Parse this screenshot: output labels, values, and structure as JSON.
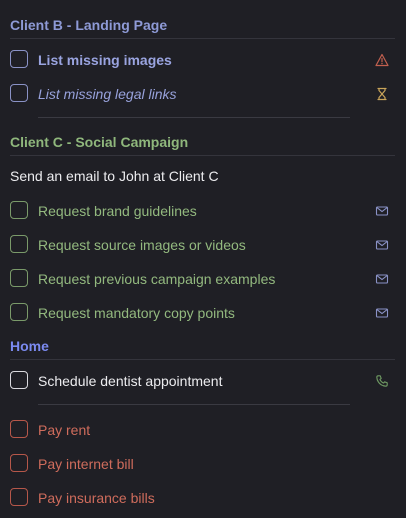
{
  "sections": {
    "client_b": {
      "title": "Client B - Landing Page",
      "tasks": [
        {
          "label": "List missing images",
          "icon": "warning-icon"
        },
        {
          "label": "List missing legal links",
          "icon": "hourglass-icon"
        }
      ]
    },
    "client_c": {
      "title": "Client C - Social Campaign",
      "subheading": "Send an email to John at Client C",
      "tasks": [
        {
          "label": "Request brand guidelines",
          "icon": "mail-icon"
        },
        {
          "label": "Request source images or videos",
          "icon": "mail-icon"
        },
        {
          "label": "Request previous campaign examples",
          "icon": "mail-icon"
        },
        {
          "label": "Request mandatory copy points",
          "icon": "mail-icon"
        }
      ]
    },
    "home": {
      "title": "Home",
      "tasks": [
        {
          "label": "Schedule dentist appointment",
          "icon": "phone-icon"
        },
        {
          "label": "Pay rent"
        },
        {
          "label": "Pay internet bill"
        },
        {
          "label": "Pay insurance bills"
        }
      ]
    }
  },
  "colors": {
    "background": "#1f1f25",
    "client_b_accent": "#8e9ad6",
    "client_c_accent": "#8fb77c",
    "home_accent": "#7b8af0",
    "bills_accent": "#cf6c5c",
    "warning_icon": "#c2604f",
    "hourglass_icon": "#c9a45a",
    "mail_icon": "#8a92c6",
    "phone_icon": "#6f9a63"
  }
}
